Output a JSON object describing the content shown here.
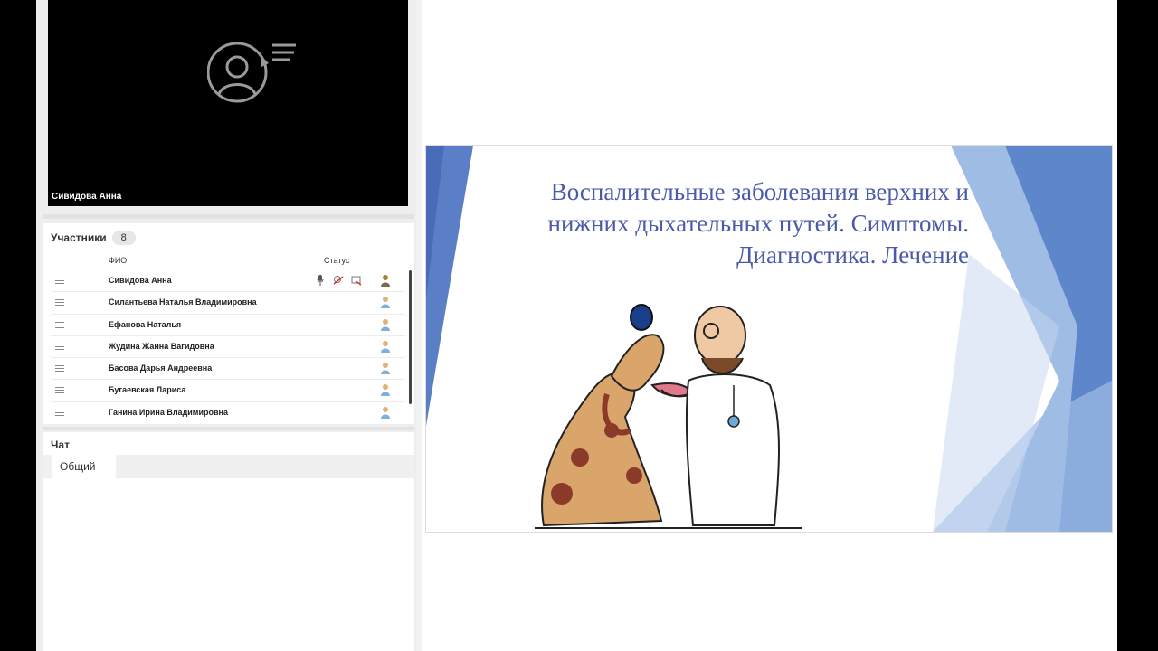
{
  "video": {
    "speaker_name": "Сивидова Анна"
  },
  "participants": {
    "title": "Участники",
    "count": "8",
    "col_name": "ФИО",
    "col_status": "Статус",
    "items": [
      {
        "name": "Сивидова Анна"
      },
      {
        "name": "Силантьева Наталья Владимировна"
      },
      {
        "name": "Ефанова Наталья"
      },
      {
        "name": "Жудина Жанна  Вагидовна"
      },
      {
        "name": "Басова Дарья Андреевна"
      },
      {
        "name": "Бугаевская Лариса"
      },
      {
        "name": "Ганина Ирина Владимировна"
      }
    ]
  },
  "chat": {
    "title": "Чат",
    "tab": "Общий"
  },
  "slide": {
    "title_line1": "Воспалительные заболевания верхних и",
    "title_line2": "нижних дыхательных путей. Симптомы.",
    "title_line3": "Диагностика. Лечение"
  },
  "colors": {
    "slide_title": "#4a5aa8",
    "slide_accent": "#5b7fc7"
  },
  "icons": [
    "user-speech-icon",
    "drag-handle-icon",
    "microphone-icon",
    "camera-off-icon",
    "screen-icon",
    "participant-avatar-icon"
  ]
}
